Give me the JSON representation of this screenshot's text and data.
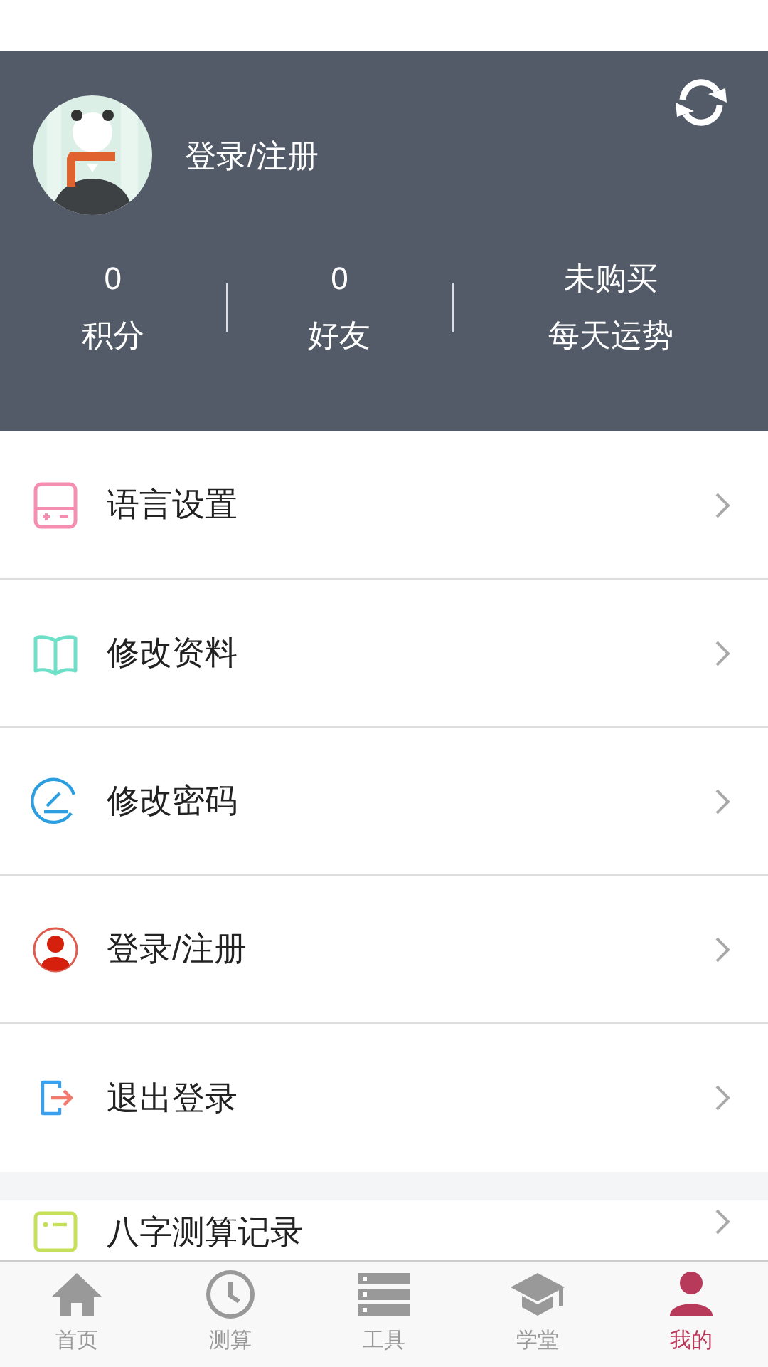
{
  "profile": {
    "login_label": "登录/注册"
  },
  "stats": [
    {
      "value": "0",
      "label": "积分"
    },
    {
      "value": "0",
      "label": "好友"
    },
    {
      "value": "未购买",
      "label": "每天运势"
    }
  ],
  "menu_groups": [
    [
      {
        "label": "语言设置"
      },
      {
        "label": "修改资料"
      },
      {
        "label": "修改密码"
      },
      {
        "label": "登录/注册"
      },
      {
        "label": "退出登录"
      }
    ],
    [
      {
        "label": "八字测算记录"
      }
    ]
  ],
  "tab_bar": [
    {
      "label": "首页",
      "selected": false
    },
    {
      "label": "测算",
      "selected": false
    },
    {
      "label": "工具",
      "selected": false
    },
    {
      "label": "学堂",
      "selected": false
    },
    {
      "label": "我的",
      "selected": true
    }
  ]
}
